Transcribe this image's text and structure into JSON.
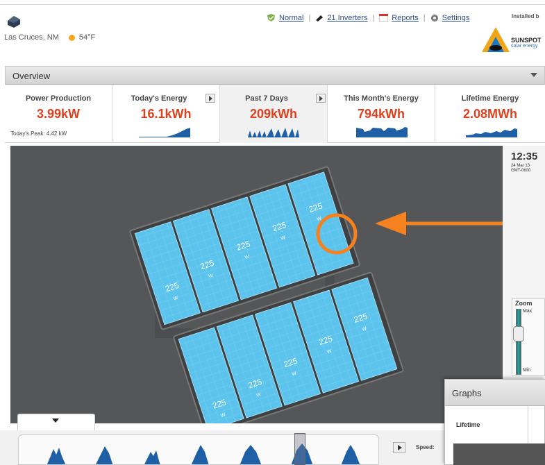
{
  "header": {
    "location": "Las Cruces, NM",
    "temperature": "54°F",
    "nav": {
      "status": "Normal",
      "inverters": "21 Inverters",
      "reports": "Reports",
      "settings": "Settings"
    },
    "installed_by": "Installed b",
    "logo_name": "SUNSPOT",
    "logo_tagline": "solar energy"
  },
  "overview": {
    "title": "Overview"
  },
  "cards": [
    {
      "label": "Power Production",
      "value": "3.99kW",
      "sub": "Today's Peak: 4.42 kW"
    },
    {
      "label": "Today's Energy",
      "value": "16.1kWh"
    },
    {
      "label": "Past 7 Days",
      "value": "209kWh"
    },
    {
      "label": "This Month's Energy",
      "value": "794kWh"
    },
    {
      "label": "Lifetime Energy",
      "value": "2.08MWh"
    }
  ],
  "panels": {
    "wattage_label": "225",
    "unit": "W"
  },
  "clock": {
    "time": "12:35",
    "date": "24 Mar 13",
    "tz": "GMT-0600"
  },
  "zoom": {
    "label": "Zoom",
    "max": "Max",
    "min": "Min"
  },
  "timeline": {
    "speed_label": "Speed:"
  },
  "graphs": {
    "title": "Graphs",
    "tab": "Lifetime"
  },
  "colors": {
    "accent_value": "#e0401e",
    "panel_blue": "#5bc3ec",
    "highlight_orange": "#f5821f",
    "spark_blue": "#1f5fa6"
  }
}
